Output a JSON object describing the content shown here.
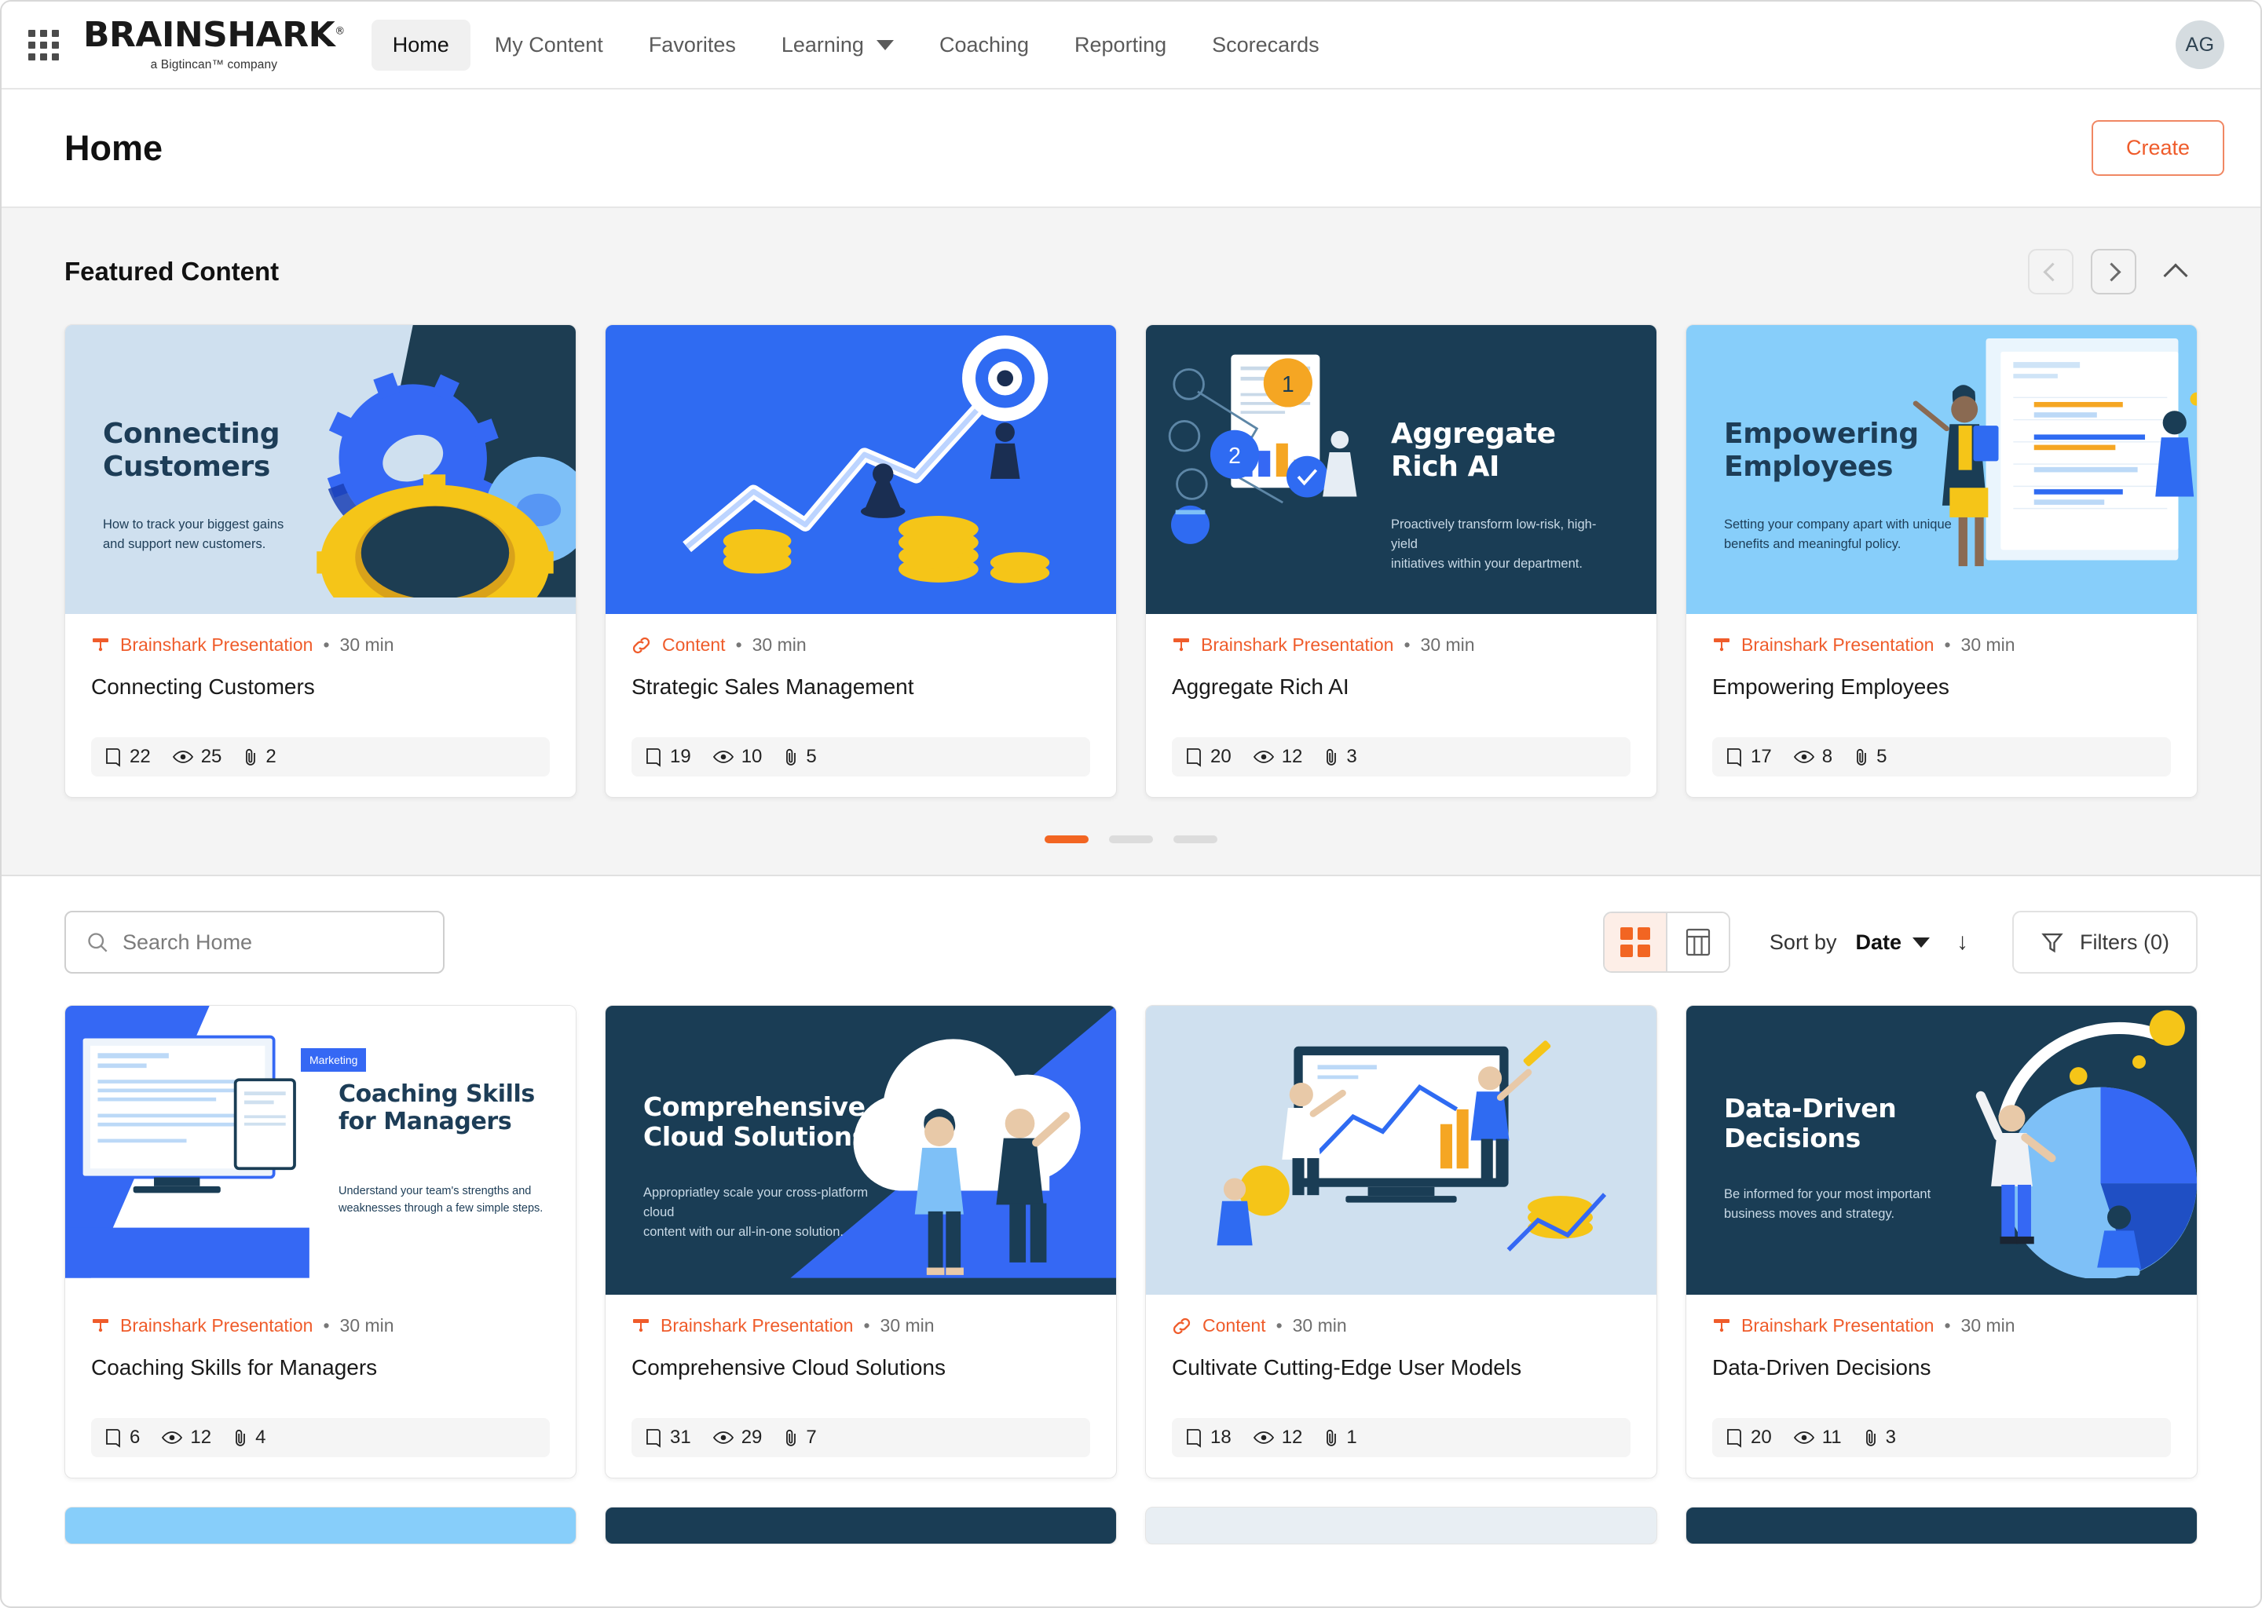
{
  "nav": {
    "apps_icon": "waffle-grid-icon",
    "logo": {
      "name": "BRAINSHARK",
      "trademark": "®",
      "tagline": "a Bigtincan™ company"
    },
    "items": [
      {
        "label": "Home",
        "active": true,
        "dropdown": false
      },
      {
        "label": "My Content",
        "active": false,
        "dropdown": false
      },
      {
        "label": "Favorites",
        "active": false,
        "dropdown": false
      },
      {
        "label": "Learning",
        "active": false,
        "dropdown": true
      },
      {
        "label": "Coaching",
        "active": false,
        "dropdown": false
      },
      {
        "label": "Reporting",
        "active": false,
        "dropdown": false
      },
      {
        "label": "Scorecards",
        "active": false,
        "dropdown": false
      }
    ],
    "avatar": {
      "initials": "AG",
      "icon": "user-avatar"
    }
  },
  "header": {
    "title": "Home",
    "create_label": "Create"
  },
  "featured": {
    "title": "Featured Content",
    "prev_icon": "chevron-left-icon",
    "next_icon": "chevron-right-icon",
    "collapse_icon": "chevron-up-icon",
    "dots": [
      true,
      false,
      false
    ],
    "cards": [
      {
        "type": "Brainshark Presentation",
        "type_icon": "presentation-icon",
        "duration": "30 min",
        "title": "Connecting Customers",
        "slides": "22",
        "views": "25",
        "attachments": "2",
        "thumb": {
          "heading": "Connecting\nCustomers",
          "sub": "How to track your biggest gains\nand support new customers.",
          "bg": "#cfe0ef",
          "text": "#1d3d57",
          "art": "gears"
        }
      },
      {
        "type": "Content",
        "type_icon": "link-icon",
        "duration": "30 min",
        "title": "Strategic Sales Management",
        "slides": "19",
        "views": "10",
        "attachments": "5",
        "thumb": {
          "heading": "",
          "sub": "",
          "bg": "#2f6bf2",
          "text": "#ffffff",
          "art": "growth-chart"
        }
      },
      {
        "type": "Brainshark Presentation",
        "type_icon": "presentation-icon",
        "duration": "30 min",
        "title": "Aggregate Rich AI",
        "slides": "20",
        "views": "12",
        "attachments": "3",
        "thumb": {
          "heading": "Aggregate\nRich AI",
          "sub": "Proactively transform low-risk, high-yield\ninitiatives within your department.",
          "bg": "#1a3d55",
          "text": "#ffffff",
          "art": "diagram-nodes",
          "align": "right"
        }
      },
      {
        "type": "Brainshark Presentation",
        "type_icon": "presentation-icon",
        "duration": "30 min",
        "title": "Empowering Employees",
        "slides": "17",
        "views": "8",
        "attachments": "5",
        "thumb": {
          "heading": "Empowering\nEmployees",
          "sub": "Setting your company apart with unique\nbenefits and meaningful policy.",
          "bg": "#87cefa",
          "text": "#1d3d57",
          "art": "presenter-dashboard"
        }
      }
    ]
  },
  "toolbar": {
    "search_placeholder": "Search Home",
    "search_value": "",
    "search_icon": "search-icon",
    "grid_view_icon": "grid-view-icon",
    "table_view_icon": "table-view-icon",
    "sort_label": "Sort by",
    "sort_value": "Date",
    "sort_direction_icon": "arrow-down-icon",
    "filters_label": "Filters (0)",
    "filters_icon": "funnel-icon"
  },
  "results": {
    "cards": [
      {
        "type": "Brainshark Presentation",
        "type_icon": "presentation-icon",
        "duration": "30 min",
        "title": "Coaching Skills for Managers",
        "slides": "6",
        "views": "12",
        "attachments": "4",
        "thumb": {
          "tag": "Marketing",
          "heading": "Coaching Skills\nfor Managers",
          "sub": "Understand your team's strengths and\nweaknesses through a few simple steps.",
          "bg": "#ffffff",
          "text": "#1d3d57",
          "art": "monitor-mockup",
          "align": "right"
        }
      },
      {
        "type": "Brainshark Presentation",
        "type_icon": "presentation-icon",
        "duration": "30 min",
        "title": "Comprehensive Cloud Solutions",
        "slides": "31",
        "views": "29",
        "attachments": "7",
        "thumb": {
          "heading": "Comprehensive\nCloud Solutions",
          "sub": "Appropriatley scale your cross-platform cloud\ncontent with our all-in-one solution.",
          "bg": "#1a3d55",
          "text": "#ffffff",
          "art": "cloud-people"
        }
      },
      {
        "type": "Content",
        "type_icon": "link-icon",
        "duration": "30 min",
        "title": "Cultivate Cutting-Edge User Models",
        "slides": "18",
        "views": "12",
        "attachments": "1",
        "thumb": {
          "heading": "",
          "sub": "",
          "bg": "#cfe0ef",
          "text": "#1d3d57",
          "art": "dashboard-team"
        }
      },
      {
        "type": "Brainshark Presentation",
        "type_icon": "presentation-icon",
        "duration": "30 min",
        "title": "Data-Driven Decisions",
        "slides": "20",
        "views": "11",
        "attachments": "3",
        "thumb": {
          "heading": "Data-Driven\nDecisions",
          "sub": "Be informed for your most important\nbusiness moves and strategy.",
          "bg": "#1a3d55",
          "text": "#ffffff",
          "art": "pie-chart-people"
        }
      }
    ],
    "partial_row": [
      {
        "bg": "#87cefa"
      },
      {
        "bg": "#1a3d55"
      },
      {
        "bg": "#e8eef3"
      },
      {
        "bg": "#1a3d55"
      }
    ]
  },
  "colors": {
    "accent": "#f26522",
    "accent_text": "#ef5c2b",
    "navy": "#1a3d55",
    "blue": "#2f6bf2",
    "yellow": "#f5c518"
  }
}
